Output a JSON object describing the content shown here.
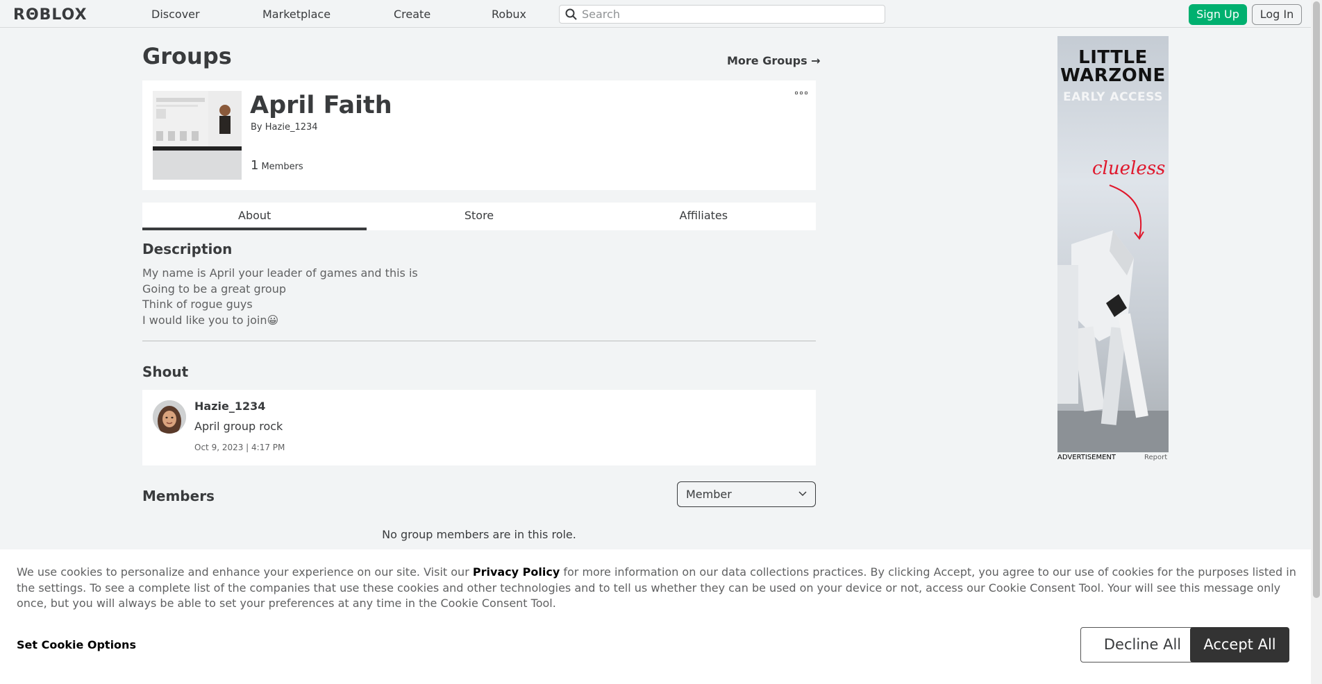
{
  "nav": {
    "logo": "RΘBLOX",
    "links": [
      "Discover",
      "Marketplace",
      "Create",
      "Robux"
    ],
    "search_placeholder": "Search",
    "signup": "Sign Up",
    "login": "Log In"
  },
  "page": {
    "title": "Groups",
    "more_groups": "More Groups →"
  },
  "group": {
    "name": "April Faith",
    "by_prefix": "By",
    "owner": "Hazie_1234",
    "member_count": "1",
    "member_label": "Members"
  },
  "tabs": [
    "About",
    "Store",
    "Affiliates"
  ],
  "description": {
    "heading": "Description",
    "lines": [
      "My name is April your leader of games and this is",
      "Going to be a great group",
      "Think of rogue guys",
      "I would like you to join😀"
    ]
  },
  "shout": {
    "heading": "Shout",
    "user": "Hazie_1234",
    "text": "April group rock",
    "date": "Oct 9, 2023 | 4:17 PM"
  },
  "members": {
    "heading": "Members",
    "role": "Member",
    "empty": "No group members are in this role."
  },
  "ad": {
    "title_line1": "LITTLE",
    "title_line2": "WARZONE",
    "subtitle": "EARLY ACCESS",
    "tagline": "clueless",
    "label": "ADVERTISEMENT",
    "report": "Report"
  },
  "cookie": {
    "text_before": "We use cookies to personalize and enhance your experience on our site. Visit our ",
    "policy_link": "Privacy Policy",
    "text_after": " for more information on our data collections practices. By clicking Accept, you agree to our use of cookies for the purposes listed in the settings. To see a complete list of the companies that use these cookies and other technologies and to tell us whether they can be used on your device or not, access our Cookie Consent Tool. Your will see this message only once, but you will always be able to set your preferences at any time in the Cookie Consent Tool.",
    "options": "Set Cookie Options",
    "decline": "Decline All",
    "accept": "Accept All"
  }
}
